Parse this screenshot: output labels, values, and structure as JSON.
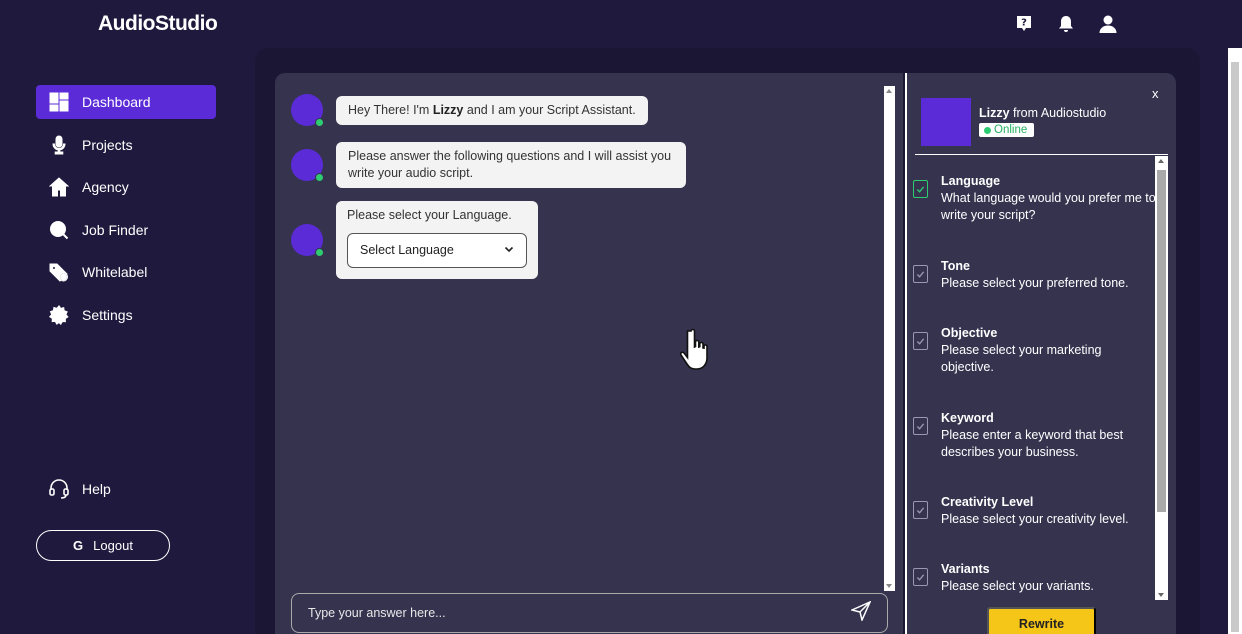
{
  "header": {
    "logo": "AudioStudio",
    "icons": [
      "help-icon",
      "bell-icon",
      "user-icon"
    ]
  },
  "sidebar": {
    "items": [
      {
        "label": "Dashboard",
        "icon": "dashboard-icon",
        "active": true
      },
      {
        "label": "Projects",
        "icon": "microphone-icon",
        "active": false
      },
      {
        "label": "Agency",
        "icon": "home-icon",
        "active": false
      },
      {
        "label": "Job Finder",
        "icon": "search-icon",
        "active": false
      },
      {
        "label": "Whitelabel",
        "icon": "tag-icon",
        "active": false
      },
      {
        "label": "Settings",
        "icon": "gear-icon",
        "active": false
      }
    ],
    "help_label": "Help",
    "logout_label": "Logout",
    "logout_glyph": "G"
  },
  "chat": {
    "msg1_pre": "Hey There! I'm ",
    "msg1_name": "Lizzy",
    "msg1_post": " and I am your Script Assistant.",
    "msg2": "Please answer the following questions and I will assist you write your audio script.",
    "msg3": "Please select your Language.",
    "language_select": "Select Language",
    "input_placeholder": "Type your answer here..."
  },
  "assistant": {
    "close": "x",
    "name": "Lizzy",
    "name_suffix": " from Audiostudio",
    "status": "Online"
  },
  "questions": [
    {
      "title": "Language",
      "text": "What language would you prefer me to write your script?",
      "done": true
    },
    {
      "title": "Tone",
      "text": "Please select your preferred tone.",
      "done": false
    },
    {
      "title": "Objective",
      "text": "Please select your marketing objective.",
      "done": false
    },
    {
      "title": "Keyword",
      "text": "Please enter a keyword that best describes your business.",
      "done": false
    },
    {
      "title": "Creativity Level",
      "text": "Please select your creativity level.",
      "done": false
    },
    {
      "title": "Variants",
      "text": "Please select your variants.",
      "done": false
    }
  ],
  "rewrite_label": "Rewrite",
  "colors": {
    "background": "#1f1a3d",
    "panel": "#36334f",
    "accent": "#5b2bd8",
    "online": "#2ecc71",
    "rewrite": "#f5c518"
  }
}
